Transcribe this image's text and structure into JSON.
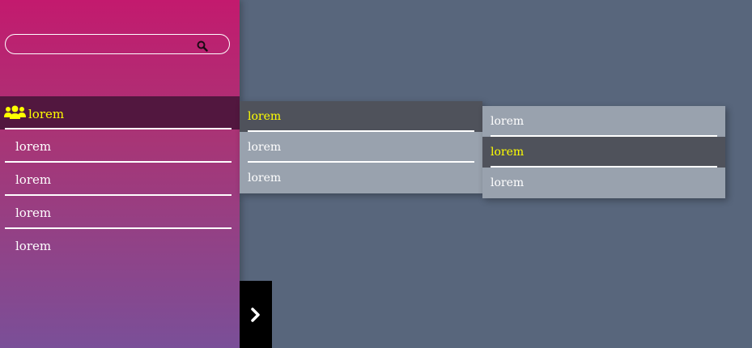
{
  "search": {
    "value": "",
    "placeholder": "",
    "icon": "search-icon"
  },
  "sidebar": {
    "items": [
      {
        "label": "lorem",
        "icon": "users-icon",
        "active": true
      },
      {
        "label": "lorem",
        "active": false
      },
      {
        "label": "lorem",
        "active": false
      },
      {
        "label": "lorem",
        "active": false
      },
      {
        "label": "lorem",
        "active": false
      }
    ]
  },
  "submenu1": {
    "items": [
      {
        "label": "lorem",
        "active": true
      },
      {
        "label": "lorem",
        "active": false
      },
      {
        "label": "lorem",
        "active": false
      }
    ]
  },
  "submenu2": {
    "items": [
      {
        "label": "lorem",
        "active": false
      },
      {
        "label": "lorem",
        "active": true
      },
      {
        "label": "lorem",
        "active": false
      }
    ]
  },
  "toggle": {
    "icon": "chevron-right-icon"
  },
  "colors": {
    "active_text": "#ffff00",
    "background": "#58667c",
    "active_item_bg": "#52173f",
    "submenu_bg": "#99a2ae",
    "submenu_active_bg": "#4f525b"
  }
}
